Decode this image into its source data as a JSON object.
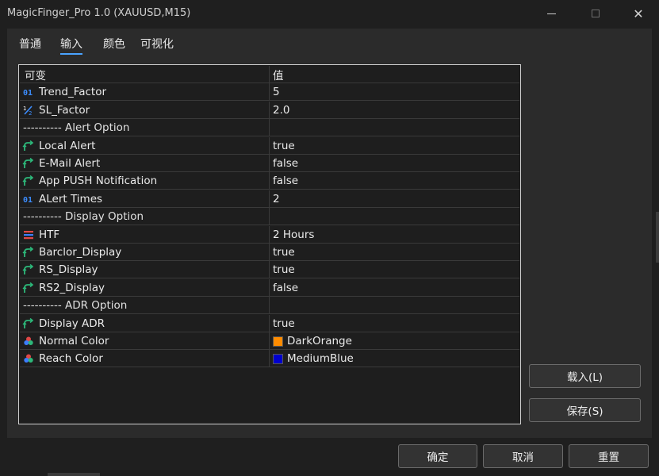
{
  "window": {
    "title": "MagicFinger_Pro 1.0 (XAUUSD,M15)",
    "close_glyph": "✕"
  },
  "tabs": [
    {
      "label": "普通"
    },
    {
      "label": "输入",
      "active": true
    },
    {
      "label": "颜色"
    },
    {
      "label": "可视化"
    }
  ],
  "grid": {
    "headers": {
      "variable": "可变",
      "value": "值"
    },
    "rows": [
      {
        "icon": "integer-icon",
        "name": "Trend_Factor",
        "value": "5"
      },
      {
        "icon": "fraction-icon",
        "name": "SL_Factor",
        "value": "2.0"
      },
      {
        "icon": "",
        "name": "---------- Alert Option",
        "value": "",
        "separator": true
      },
      {
        "icon": "boolean-icon",
        "name": "Local Alert",
        "value": "true"
      },
      {
        "icon": "boolean-icon",
        "name": "E-Mail Alert",
        "value": "false"
      },
      {
        "icon": "boolean-icon",
        "name": "App PUSH Notification",
        "value": "false"
      },
      {
        "icon": "integer-icon",
        "name": "ALert Times",
        "value": "2"
      },
      {
        "icon": "",
        "name": "---------- Display Option",
        "value": "",
        "separator": true
      },
      {
        "icon": "enum-icon",
        "name": "HTF",
        "value": "2 Hours"
      },
      {
        "icon": "boolean-icon",
        "name": "Barclor_Display",
        "value": "true"
      },
      {
        "icon": "boolean-icon",
        "name": "RS_Display",
        "value": "true"
      },
      {
        "icon": "boolean-icon",
        "name": "RS2_Display",
        "value": "false"
      },
      {
        "icon": "",
        "name": "---------- ADR Option",
        "value": "",
        "separator": true
      },
      {
        "icon": "boolean-icon",
        "name": "Display ADR",
        "value": "true"
      },
      {
        "icon": "color-icon",
        "name": "Normal Color",
        "value": "DarkOrange",
        "swatch": "#ff8c00"
      },
      {
        "icon": "color-icon",
        "name": "Reach Color",
        "value": "MediumBlue",
        "swatch": "#0000cd"
      }
    ]
  },
  "side_buttons": {
    "load": "载入(L)",
    "save": "保存(S)"
  },
  "footer_buttons": {
    "ok": "确定",
    "cancel": "取消",
    "reset": "重置"
  },
  "colors": {
    "accent": "#4aa3ff",
    "integer_icon": "#3c8dff",
    "bool_icon": "#2db87a"
  }
}
